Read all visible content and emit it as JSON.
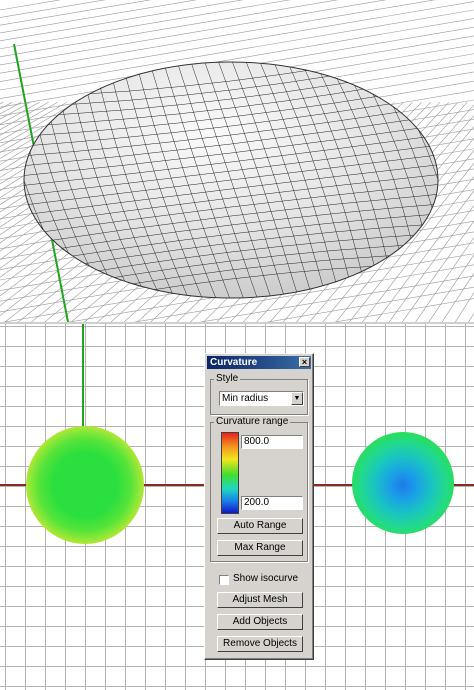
{
  "viewports": {
    "top": {
      "label": "perspective-mesh-view"
    },
    "bottom": {
      "label": "top-curvature-view"
    }
  },
  "curvature_dialog": {
    "title": "Curvature",
    "close_glyph": "×",
    "style_label": "Style",
    "style_value": "Min radius",
    "range_label": "Curvature range",
    "range_max": "800.0",
    "range_min": "200.0",
    "auto_range_label": "Auto Range",
    "max_range_label": "Max Range",
    "show_isocurve_label": "Show isocurve",
    "show_isocurve_checked": false,
    "adjust_mesh_label": "Adjust Mesh",
    "add_objects_label": "Add Objects",
    "remove_objects_label": "Remove Objects"
  },
  "colors": {
    "accent_title": "#0a246a",
    "grid_line": "#b3b3b3",
    "axis_x": "#8a2b1f",
    "axis_y": "#1fa51f"
  }
}
